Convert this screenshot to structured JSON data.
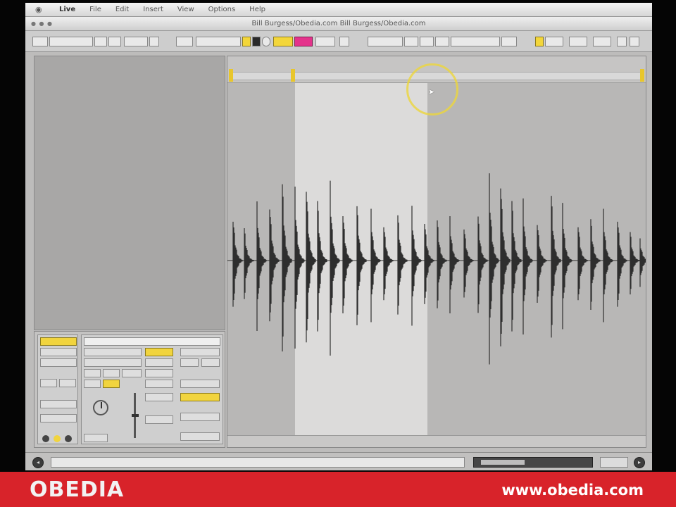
{
  "menubar": {
    "items": [
      "Live",
      "File",
      "Edit",
      "Insert",
      "View",
      "Options",
      "Help"
    ]
  },
  "titlebar": {
    "title": "Bill Burgess/Obedia.com   Bill Burgess/Obedia.com"
  },
  "colors": {
    "accent_yellow": "#f3d63a",
    "accent_pink": "#e4328b",
    "brand_red": "#d8232a",
    "waveform": "#2f2f2f"
  },
  "icons": {
    "apple": "apple-icon",
    "cursor": "cursor-arrow-icon",
    "browser_toggle": "circle-arrow-icon",
    "knob": "knob-icon"
  },
  "brand": {
    "logo": "OBEDIA",
    "url": "www.obedia.com"
  }
}
